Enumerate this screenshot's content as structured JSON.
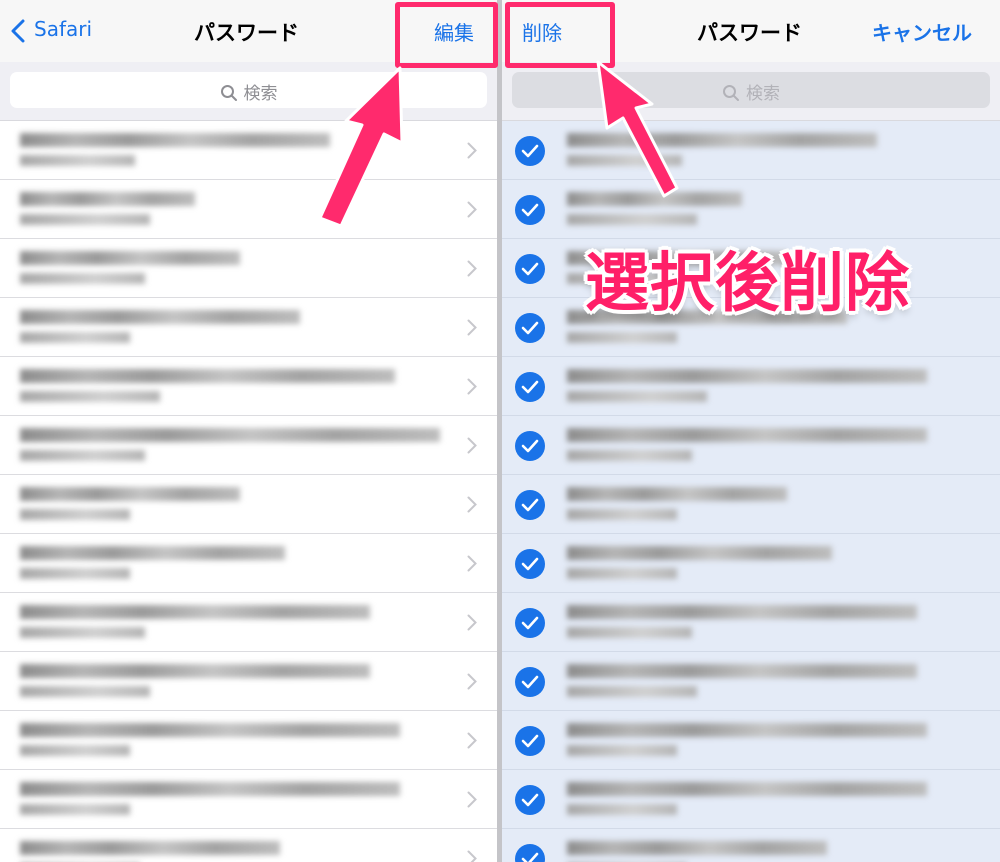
{
  "left": {
    "back_label": "Safari",
    "title": "パスワード",
    "edit_label": "編集",
    "search_placeholder": "検索"
  },
  "right": {
    "delete_label": "削除",
    "title": "パスワード",
    "cancel_label": "キャンセル",
    "search_placeholder": "検索"
  },
  "annotation": {
    "text": "選択後削除",
    "color": "#ff1f68"
  },
  "colors": {
    "accent": "#1a73e8",
    "highlight": "#ff2a6d"
  },
  "icons": [
    "chevron-left-icon",
    "search-icon",
    "chevron-right-icon",
    "checkmark-icon"
  ],
  "rows_visible": 13
}
